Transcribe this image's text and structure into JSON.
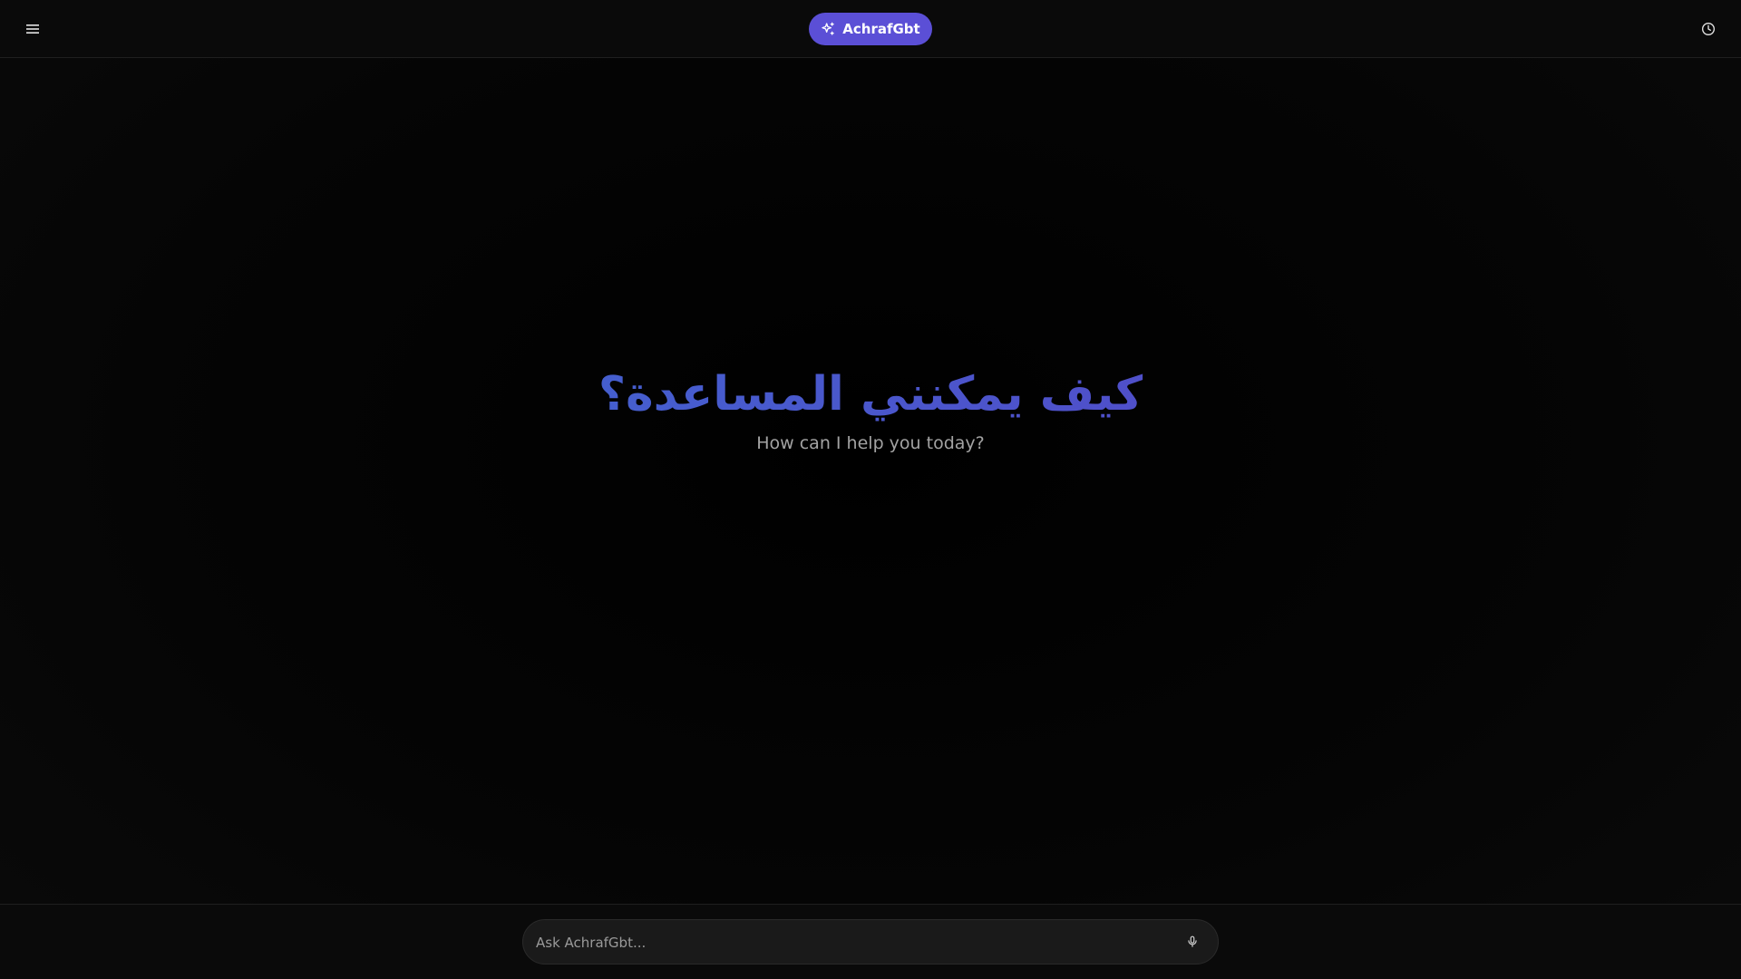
{
  "header": {
    "menu_icon": "hamburger-menu-icon",
    "brand": {
      "icon": "sparkles-icon",
      "label": "AchrafGbt",
      "color": "#5b4fd6"
    },
    "history_icon": "clock-icon"
  },
  "hero": {
    "title": "كيف يمكنني المساعدة؟",
    "subtitle": "How can I help you today?",
    "gradient": [
      "#3a6fd4",
      "#5a3fc4"
    ]
  },
  "composer": {
    "placeholder": "Ask AchrafGbt...",
    "value": "",
    "mic_icon": "microphone-icon"
  }
}
